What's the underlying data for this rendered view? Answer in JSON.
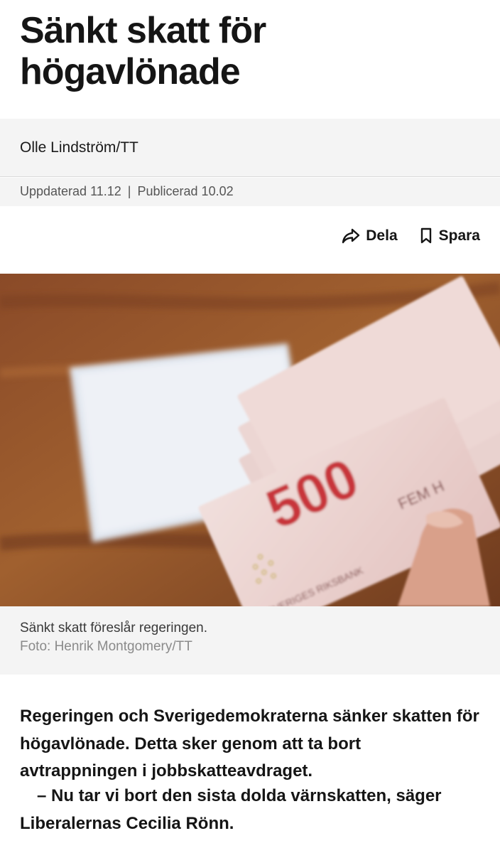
{
  "article": {
    "headline": "Sänkt skatt för högavlönade",
    "author": "Olle Lindström/TT",
    "updated": "Uppdaterad 11.12",
    "separator": "|",
    "published": "Publicerad 10.02",
    "actions": {
      "share_label": "Dela",
      "save_label": "Spara",
      "share_icon": "share-arrow-icon",
      "save_icon": "bookmark-icon"
    },
    "image": {
      "caption": "Sänkt skatt föreslår regeringen.",
      "credit": "Foto: Henrik Montgomery/TT",
      "banknote_value": "500",
      "banknote_text_1": "SVERIGES RIKSBANK",
      "banknote_text_2": "FEM H"
    },
    "lead": "Regeringen och Sverigedemokraterna sänker skatten för högavlönade. Detta sker genom att ta bort avtrappningen i jobbskatteavdraget.",
    "quote": "– Nu tar vi bort den sista dolda värnskatten, säger Liberalernas Cecilia Rönn."
  },
  "colors": {
    "headline": "#151515",
    "panel_bg": "#f4f4f4",
    "meta_text": "#555555",
    "credit_text": "#8a8a8a",
    "banknote_red": "#c8353a"
  }
}
